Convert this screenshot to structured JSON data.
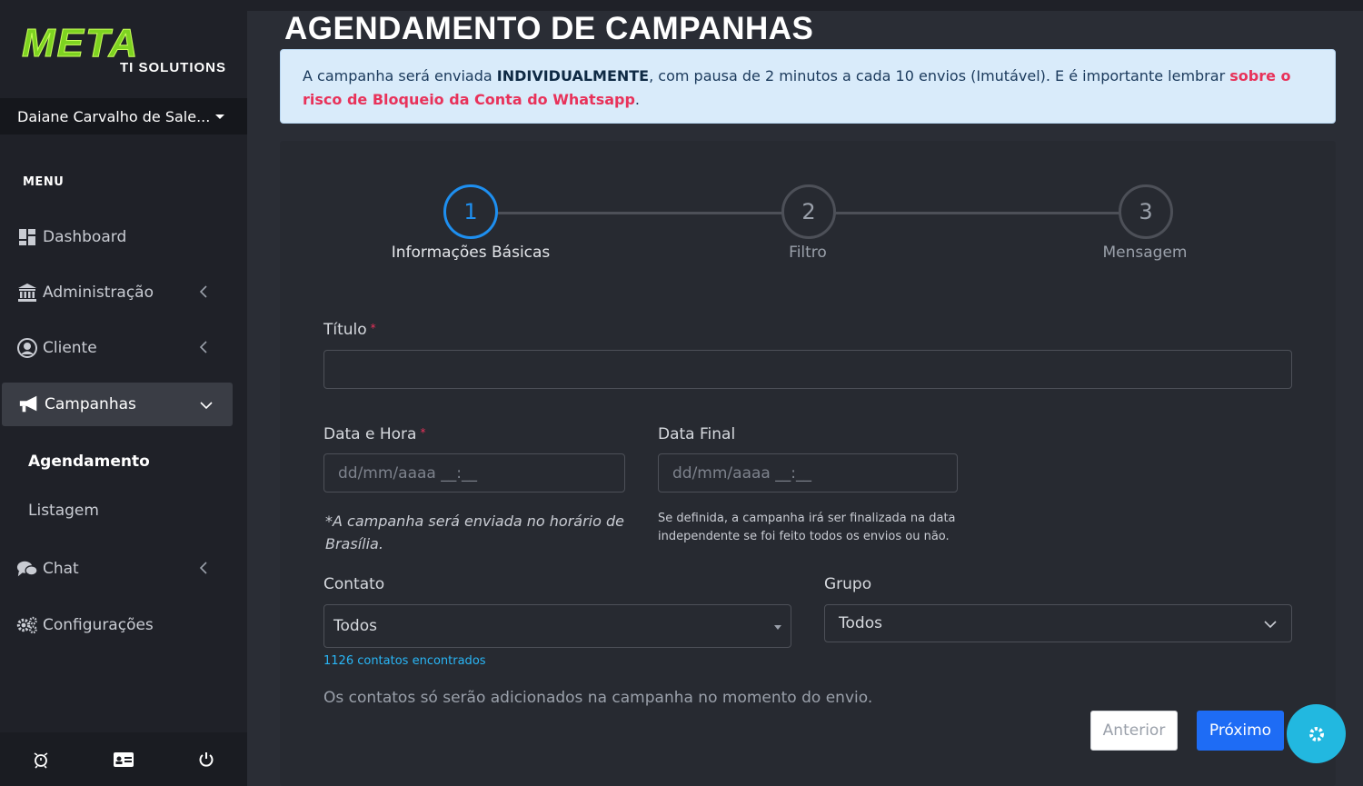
{
  "brand": {
    "name": "META",
    "tagline": "TI SOLUTIONS"
  },
  "user": {
    "name": "Daiane Carvalho de Sale..."
  },
  "menu": {
    "title": "MENU",
    "items": [
      {
        "label": "Dashboard",
        "icon": "dashboard-icon"
      },
      {
        "label": "Administração",
        "icon": "bank-icon"
      },
      {
        "label": "Cliente",
        "icon": "user-circle-icon"
      },
      {
        "label": "Campanhas",
        "icon": "megaphone-icon"
      },
      {
        "label": "Chat",
        "icon": "chat-icon"
      },
      {
        "label": "Configurações",
        "icon": "gears-icon"
      }
    ],
    "subitems": [
      {
        "label": "Agendamento"
      },
      {
        "label": "Listagem"
      }
    ]
  },
  "page": {
    "title": "AGENDAMENTO DE CAMPANHAS"
  },
  "alert": {
    "prefix": "A campanha será enviada ",
    "bold": "INDIVIDUALMENTE",
    "middle": ", com pausa de 2 minutos a cada 10 envios (Imutável). E é importante lembrar ",
    "danger": "sobre o risco de Bloqueio da Conta do Whatsapp",
    "suffix": "."
  },
  "steps": [
    {
      "number": "1",
      "label": "Informações Básicas",
      "active": true
    },
    {
      "number": "2",
      "label": "Filtro",
      "active": false
    },
    {
      "number": "3",
      "label": "Mensagem",
      "active": false
    }
  ],
  "form": {
    "titulo": {
      "label": "Título",
      "required": "*",
      "value": ""
    },
    "data_hora": {
      "label": "Data e Hora",
      "required": "*",
      "placeholder": "dd/mm/aaaa __:__",
      "note": "*A campanha será enviada no horário de Brasília."
    },
    "data_final": {
      "label": "Data Final",
      "placeholder": "dd/mm/aaaa __:__",
      "hint": "Se definida, a campanha irá ser finalizada na data independente se foi feito todos os envios ou não."
    },
    "contato": {
      "label": "Contato",
      "value": "Todos",
      "count": "1126 contatos encontrados"
    },
    "grupo": {
      "label": "Grupo",
      "value": "Todos"
    },
    "info": "Os contatos só serão adicionados na campanha no momento do envio."
  },
  "buttons": {
    "prev": "Anterior",
    "next": "Próximo"
  },
  "colors": {
    "accent": "#1e8ff0",
    "primary_button": "#1e6cf5",
    "danger": "#e8325a",
    "brand_green": "#7ed321",
    "fab": "#22b8e0"
  }
}
